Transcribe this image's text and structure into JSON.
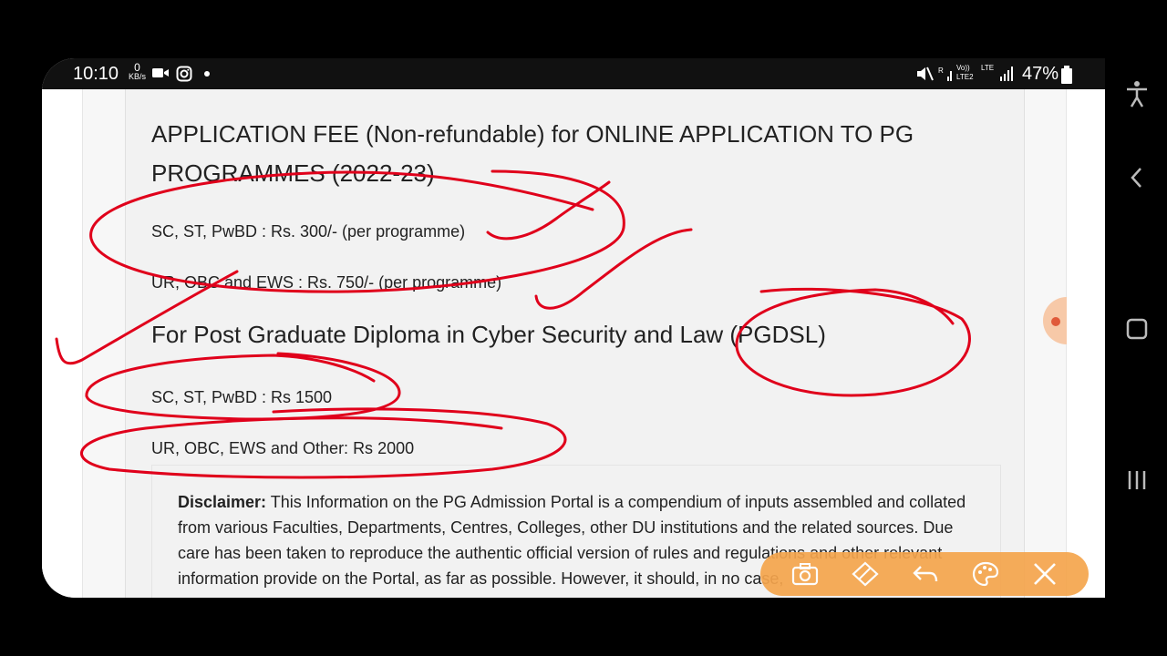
{
  "status_bar": {
    "time": "10:10",
    "kbs_value": "0",
    "kbs_unit": "KB/s",
    "network_lte_top": "Vo)) LTE2",
    "network_lte_right": "LTE",
    "battery": "47%"
  },
  "content": {
    "heading_fee": "APPLICATION FEE (Non-refundable) for ONLINE APPLICATION TO PG PROGRAMMES (2022-23)",
    "fee_sc_st": "SC, ST, PwBD : Rs. 300/- (per programme)",
    "fee_ur_obc": "UR, OBC and EWS : Rs. 750/- (per programme)",
    "heading_pgdsl": "For Post Graduate Diploma in Cyber Security and Law (PGDSL)",
    "pgdsl_sc_st": "SC, ST, PwBD : Rs 1500",
    "pgdsl_ur_obc": "UR, OBC, EWS and Other: Rs 2000",
    "disclaimer_label": "Disclaimer:",
    "disclaimer_text": "This Information on the PG Admission Portal is a compendium of inputs assembled and collated from various Faculties, Departments, Centres, Colleges, other DU institutions and the related sources. Due care has been taken to reproduce the authentic official version of rules and regulations and other relevant information provide on the Portal, as far as possible. However, it should, in no case,"
  },
  "colors": {
    "annotation": "#e0001b",
    "toolbar": "#f5a54d"
  }
}
